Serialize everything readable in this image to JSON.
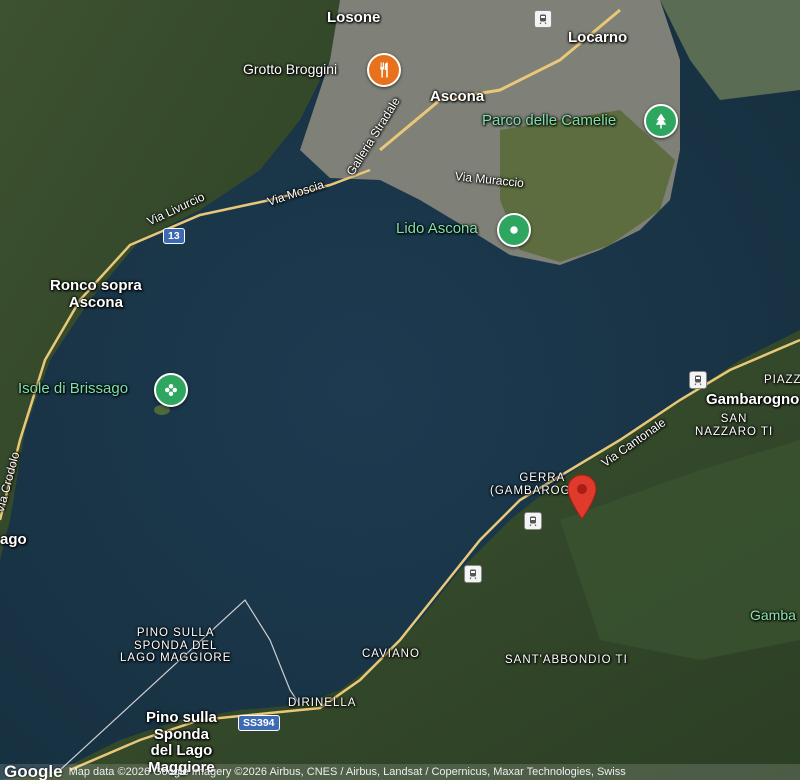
{
  "colors": {
    "lake": "#1a3347",
    "forest": "#34482a",
    "urban": "#8a8a83",
    "road_major": "#e8c878",
    "poi_green": "#2fa660",
    "poi_orange": "#e8711c",
    "pin_red": "#e03a2c"
  },
  "places": {
    "losone": "Losone",
    "locarno": "Locarno",
    "ascona": "Ascona",
    "ronco": "Ronco sopra Ascona",
    "ronco_l1": "Ronco sopra",
    "ronco_l2": "Ascona",
    "gerra_l1": "GERRA",
    "gerra_l2": "(GAMBAROGNO)",
    "gambarogno": "Gambarogno",
    "piazzogna": "PIAZZ",
    "san_nazzaro_l1": "SAN",
    "san_nazzaro_l2": "NAZZARO TI",
    "caviano": "CAVIANO",
    "sant_abbondio": "SANT'ABBONDIO TI",
    "dirinella": "DIRINELLA",
    "pino_upper_l1": "PINO SULLA",
    "pino_upper_l2": "SPONDA DEL",
    "pino_upper_l3": "LAGO MAGGIORE",
    "pino_l1": "Pino sulla",
    "pino_l2": "Sponda",
    "pino_l3": "del Lago",
    "pino_l4": "Maggiore",
    "gamba_edge": "Gamba",
    "ago_edge": "ago"
  },
  "pois": {
    "grotto": "Grotto Broggini",
    "parco": "Parco delle Camelie",
    "lido": "Lido Ascona",
    "isole": "Isole di Brissago"
  },
  "roads": {
    "livurcio": "Via Livurcio",
    "moscia": "Via Moscia",
    "galleria": "Galleria Stradale",
    "muraccio": "Via Muraccio",
    "cantonale": "Via Cantonale",
    "crodolo": "Via Crodolo",
    "route13": "13",
    "ss394": "SS394"
  },
  "icons": {
    "restaurant": "fork-knife-icon",
    "park": "tree-icon",
    "beach": "pin-dot-icon",
    "garden": "flower-icon",
    "train": "train-icon",
    "selected_pin": "red-map-pin-icon"
  },
  "attribution": {
    "logo": "Google",
    "text": "Map data ©2026 Google Imagery ©2026 Airbus, CNES / Airbus, Landsat / Copernicus, Maxar Technologies, Swiss"
  }
}
